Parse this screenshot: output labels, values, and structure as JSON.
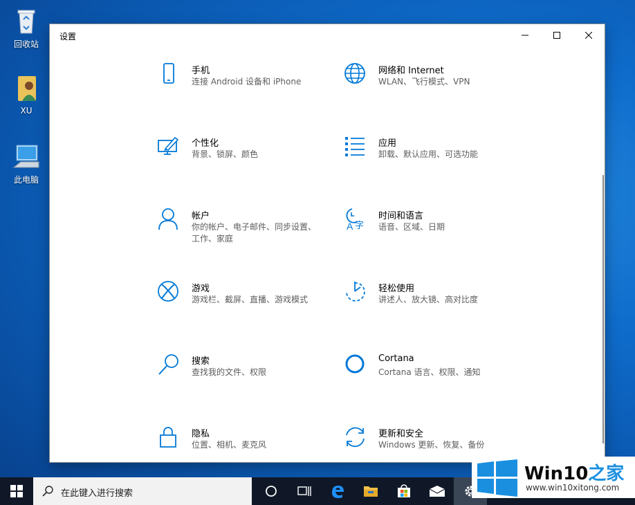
{
  "desktop": {
    "icons": [
      {
        "label": "回收站",
        "icon": "recycle-bin-icon"
      },
      {
        "label": "XU",
        "icon": "user-folder-icon"
      },
      {
        "label": "此电脑",
        "icon": "this-pc-icon"
      }
    ]
  },
  "window": {
    "title": "设置",
    "controls": [
      "minimize-icon",
      "maximize-icon",
      "close-icon"
    ]
  },
  "settings": {
    "items": [
      {
        "name": "手机",
        "desc": "连接 Android 设备和 iPhone",
        "icon": "phone-icon"
      },
      {
        "name": "网络和 Internet",
        "desc": "WLAN、飞行模式、VPN",
        "icon": "globe-icon"
      },
      {
        "name": "个性化",
        "desc": "背景、锁屏、颜色",
        "icon": "personalization-icon"
      },
      {
        "name": "应用",
        "desc": "卸载、默认应用、可选功能",
        "icon": "apps-list-icon"
      },
      {
        "name": "帐户",
        "desc": "你的帐户、电子邮件、同步设置、工作、家庭",
        "icon": "account-icon"
      },
      {
        "name": "时间和语言",
        "desc": "语音、区域、日期",
        "icon": "time-language-icon"
      },
      {
        "name": "游戏",
        "desc": "游戏栏、截屏、直播、游戏模式",
        "icon": "xbox-icon"
      },
      {
        "name": "轻松使用",
        "desc": "讲述人、放大镜、高对比度",
        "icon": "ease-of-access-icon"
      },
      {
        "name": "搜索",
        "desc": "查找我的文件、权限",
        "icon": "search-icon"
      },
      {
        "name": "Cortana",
        "desc": "Cortana 语言、权限、通知",
        "icon": "cortana-icon"
      },
      {
        "name": "隐私",
        "desc": "位置、相机、麦克风",
        "icon": "lock-icon"
      },
      {
        "name": "更新和安全",
        "desc": "Windows 更新、恢复、备份",
        "icon": "update-icon"
      }
    ]
  },
  "taskbar": {
    "search_placeholder": "在此键入进行搜索",
    "buttons": [
      "start-icon",
      "cortana-circle-icon",
      "task-view-icon",
      "edge-icon",
      "file-explorer-icon",
      "store-icon",
      "mail-icon",
      "settings-gear-icon"
    ]
  },
  "watermark": {
    "brand_prefix": "Win10",
    "brand_suffix": "之家",
    "url": "www.win10xitong.com"
  },
  "colors": {
    "accent": "#0078d7",
    "taskbar": "#101828"
  }
}
